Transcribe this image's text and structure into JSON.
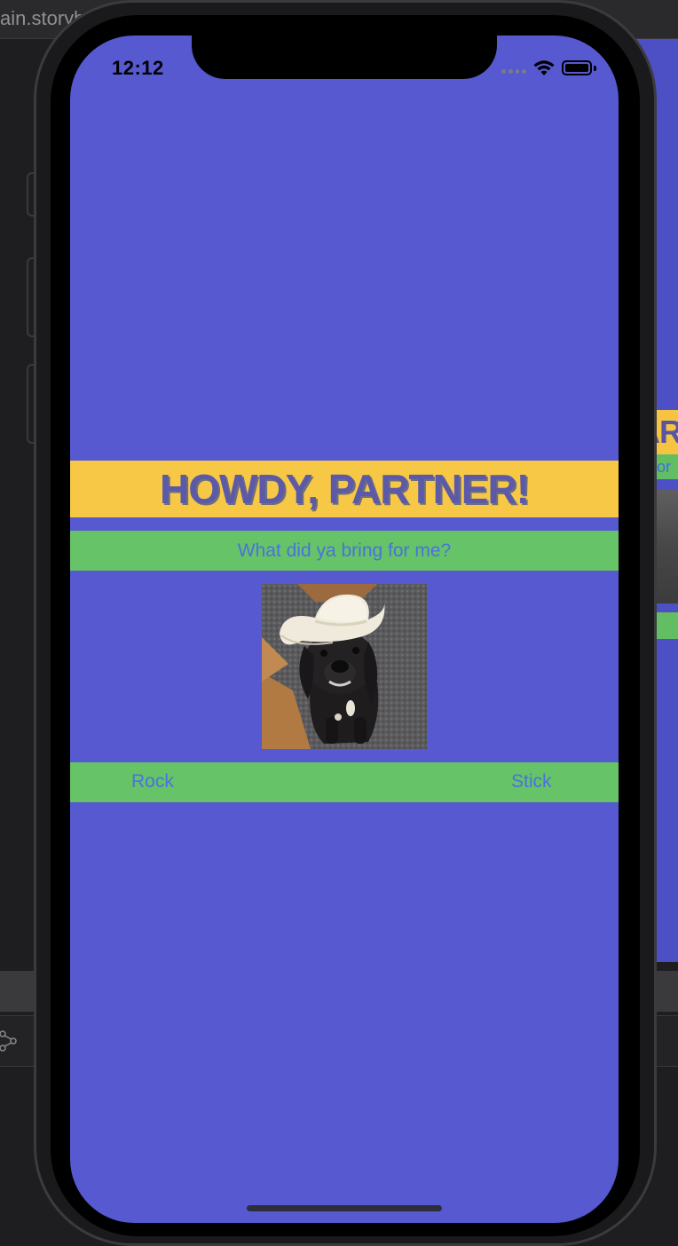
{
  "editor": {
    "tab_title": "ain.storyb"
  },
  "background_preview": {
    "title_fragment": "AR",
    "subtitle_fragment": "g for"
  },
  "status_bar": {
    "time": "12:12",
    "icons": [
      "cellular-signal-icon",
      "wifi-icon",
      "battery-icon"
    ]
  },
  "app": {
    "title": "HOWDY, PARTNER!",
    "question": "What did ya bring for me?",
    "image": "dog-in-cowboy-hat-photo",
    "buttons": {
      "rock": "Rock",
      "stick": "Stick"
    }
  },
  "colors": {
    "background": "#5659cf",
    "title_banner": "#f7c846",
    "green_banner": "#66c367",
    "title_text": "#5c5aa8",
    "button_text": "#4a72e0"
  }
}
